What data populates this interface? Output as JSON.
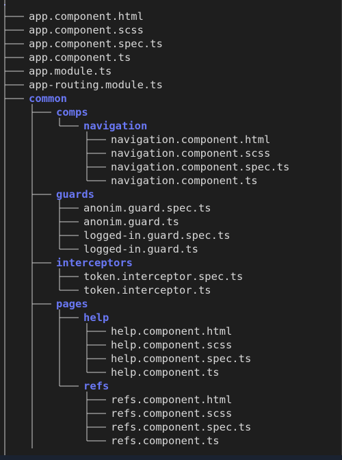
{
  "tree": [
    {
      "name": "app.component.html",
      "depth": 0,
      "type": "file"
    },
    {
      "name": "app.component.scss",
      "depth": 0,
      "type": "file"
    },
    {
      "name": "app.component.spec.ts",
      "depth": 0,
      "type": "file"
    },
    {
      "name": "app.component.ts",
      "depth": 0,
      "type": "file"
    },
    {
      "name": "app.module.ts",
      "depth": 0,
      "type": "file"
    },
    {
      "name": "app-routing.module.ts",
      "depth": 0,
      "type": "file"
    },
    {
      "name": "common",
      "depth": 0,
      "type": "dir"
    },
    {
      "name": "comps",
      "depth": 1,
      "type": "dir"
    },
    {
      "name": "navigation",
      "depth": 2,
      "type": "dir"
    },
    {
      "name": "navigation.component.html",
      "depth": 3,
      "type": "file"
    },
    {
      "name": "navigation.component.scss",
      "depth": 3,
      "type": "file"
    },
    {
      "name": "navigation.component.spec.ts",
      "depth": 3,
      "type": "file"
    },
    {
      "name": "navigation.component.ts",
      "depth": 3,
      "type": "file"
    },
    {
      "name": "guards",
      "depth": 1,
      "type": "dir"
    },
    {
      "name": "anonim.guard.spec.ts",
      "depth": 2,
      "type": "file"
    },
    {
      "name": "anonim.guard.ts",
      "depth": 2,
      "type": "file"
    },
    {
      "name": "logged-in.guard.spec.ts",
      "depth": 2,
      "type": "file"
    },
    {
      "name": "logged-in.guard.ts",
      "depth": 2,
      "type": "file"
    },
    {
      "name": "interceptors",
      "depth": 1,
      "type": "dir"
    },
    {
      "name": "token.interceptor.spec.ts",
      "depth": 2,
      "type": "file"
    },
    {
      "name": "token.interceptor.ts",
      "depth": 2,
      "type": "file"
    },
    {
      "name": "pages",
      "depth": 1,
      "type": "dir"
    },
    {
      "name": "help",
      "depth": 2,
      "type": "dir"
    },
    {
      "name": "help.component.html",
      "depth": 3,
      "type": "file"
    },
    {
      "name": "help.component.scss",
      "depth": 3,
      "type": "file"
    },
    {
      "name": "help.component.spec.ts",
      "depth": 3,
      "type": "file"
    },
    {
      "name": "help.component.ts",
      "depth": 3,
      "type": "file"
    },
    {
      "name": "refs",
      "depth": 2,
      "type": "dir"
    },
    {
      "name": "refs.component.html",
      "depth": 3,
      "type": "file"
    },
    {
      "name": "refs.component.scss",
      "depth": 3,
      "type": "file"
    },
    {
      "name": "refs.component.spec.ts",
      "depth": 3,
      "type": "file"
    },
    {
      "name": "refs.component.ts",
      "depth": 3,
      "type": "file"
    }
  ],
  "colors": {
    "background": "#1e1e1e",
    "file_text": "#d8d8d8",
    "dir_text": "#6a78f5",
    "tree_lines": "#cfcfcf",
    "bottom_bar": "#1a2230"
  }
}
